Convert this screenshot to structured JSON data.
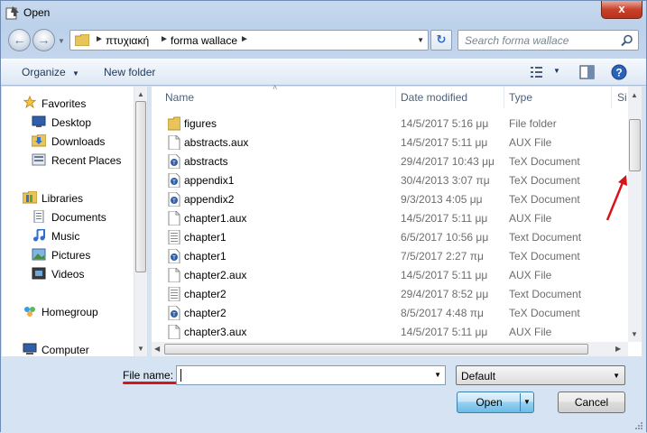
{
  "window": {
    "title": "Open",
    "close_glyph": "x"
  },
  "address": {
    "segments": [
      "πτυχιακή",
      "forma wallace"
    ]
  },
  "search": {
    "placeholder": "Search forma wallace"
  },
  "toolbar": {
    "organize": "Organize",
    "new_folder": "New folder"
  },
  "navpane": {
    "items": [
      {
        "label": "Favorites",
        "icon": "star-icon"
      },
      {
        "label": "Desktop",
        "icon": "desktop-icon"
      },
      {
        "label": "Downloads",
        "icon": "downloads-icon"
      },
      {
        "label": "Recent Places",
        "icon": "recent-places-icon"
      },
      {
        "label": "Libraries",
        "icon": "libraries-icon"
      },
      {
        "label": "Documents",
        "icon": "documents-icon"
      },
      {
        "label": "Music",
        "icon": "music-icon"
      },
      {
        "label": "Pictures",
        "icon": "pictures-icon"
      },
      {
        "label": "Videos",
        "icon": "videos-icon"
      },
      {
        "label": "Homegroup",
        "icon": "homegroup-icon"
      },
      {
        "label": "Computer",
        "icon": "computer-icon"
      }
    ]
  },
  "columns": {
    "name": "Name",
    "date": "Date modified",
    "type": "Type",
    "size": "Si"
  },
  "files": [
    {
      "name": "figures",
      "date": "14/5/2017 5:16 μμ",
      "type": "File folder",
      "icon": "folder-icon"
    },
    {
      "name": "abstracts.aux",
      "date": "14/5/2017 5:11 μμ",
      "type": "AUX File",
      "icon": "blank-file-icon"
    },
    {
      "name": "abstracts",
      "date": "29/4/2017 10:43 μμ",
      "type": "TeX Document",
      "icon": "tex-file-icon"
    },
    {
      "name": "appendix1",
      "date": "30/4/2013 3:07 πμ",
      "type": "TeX Document",
      "icon": "tex-file-icon"
    },
    {
      "name": "appendix2",
      "date": "9/3/2013 4:05 μμ",
      "type": "TeX Document",
      "icon": "tex-file-icon"
    },
    {
      "name": "chapter1.aux",
      "date": "14/5/2017 5:11 μμ",
      "type": "AUX File",
      "icon": "blank-file-icon"
    },
    {
      "name": "chapter1",
      "date": "6/5/2017 10:56 μμ",
      "type": "Text Document",
      "icon": "text-file-icon"
    },
    {
      "name": "chapter1",
      "date": "7/5/2017 2:27 πμ",
      "type": "TeX Document",
      "icon": "tex-file-icon"
    },
    {
      "name": "chapter2.aux",
      "date": "14/5/2017 5:11 μμ",
      "type": "AUX File",
      "icon": "blank-file-icon"
    },
    {
      "name": "chapter2",
      "date": "29/4/2017 8:52 μμ",
      "type": "Text Document",
      "icon": "text-file-icon"
    },
    {
      "name": "chapter2",
      "date": "8/5/2017 4:48 πμ",
      "type": "TeX Document",
      "icon": "tex-file-icon"
    },
    {
      "name": "chapter3.aux",
      "date": "14/5/2017 5:11 μμ",
      "type": "AUX File",
      "icon": "blank-file-icon"
    }
  ],
  "bottom": {
    "file_name_label": "File name:",
    "file_name_value": "",
    "filter_value": "Default",
    "open_label": "Open",
    "cancel_label": "Cancel"
  },
  "colors": {
    "annotation_red": "#d7141a",
    "accent_blue": "#2a69c4"
  }
}
